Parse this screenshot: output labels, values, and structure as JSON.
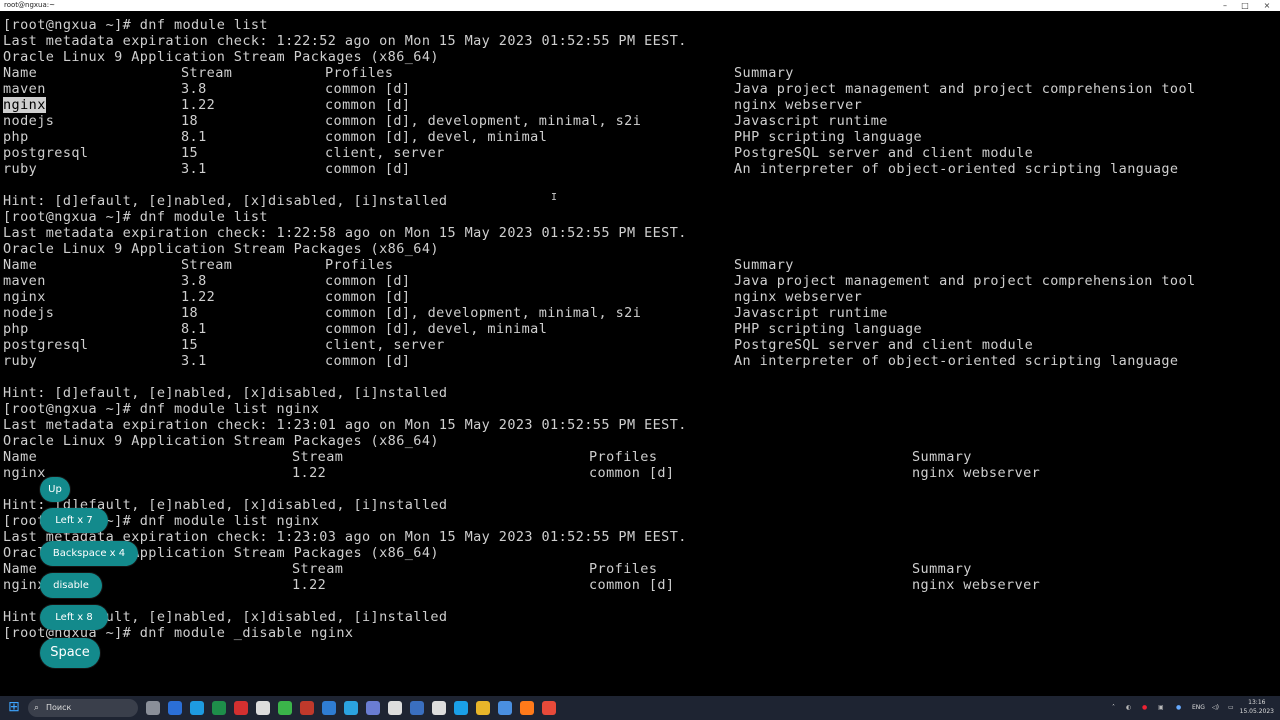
{
  "window": {
    "title": "root@ngxua:~",
    "minimize": "–",
    "maximize": "□",
    "close": "×"
  },
  "terminal": {
    "lines": [
      "[root@ngxua ~]# dnf module list",
      "Last metadata expiration check: 1:22:52 ago on Mon 15 May 2023 01:52:55 PM EEST.",
      "Oracle Linux 9 Application Stream Packages (x86_64)",
      {
        "c1": "Name",
        "c2": "Stream",
        "c3": "Profiles",
        "c4": "Summary"
      },
      {
        "c1": "maven",
        "c2": "3.8",
        "c3": "common [d]",
        "c4": "Java project management and project comprehension tool"
      },
      {
        "c1": "nginx",
        "c2": "1.22",
        "c3": "common [d]",
        "c4": "nginx webserver"
      },
      {
        "c1": "nodejs",
        "c2": "18",
        "c3": "common [d], development, minimal, s2i",
        "c4": "Javascript runtime"
      },
      {
        "c1": "php",
        "c2": "8.1",
        "c3": "common [d], devel, minimal",
        "c4": "PHP scripting language"
      },
      {
        "c1": "postgresql",
        "c2": "15",
        "c3": "client, server",
        "c4": "PostgreSQL server and client module"
      },
      {
        "c1": "ruby",
        "c2": "3.1",
        "c3": "common [d]",
        "c4": "An interpreter of object-oriented scripting language"
      },
      "",
      "Hint: [d]efault, [e]nabled, [x]disabled, [i]nstalled",
      "[root@ngxua ~]# dnf module list",
      "Last metadata expiration check: 1:22:58 ago on Mon 15 May 2023 01:52:55 PM EEST.",
      "Oracle Linux 9 Application Stream Packages (x86_64)",
      {
        "c1": "Name",
        "c2": "Stream",
        "c3": "Profiles",
        "c4": "Summary"
      },
      {
        "c1": "maven",
        "c2": "3.8",
        "c3": "common [d]",
        "c4": "Java project management and project comprehension tool"
      },
      {
        "c1": "nginx",
        "c2": "1.22",
        "c3": "common [d]",
        "c4": "nginx webserver"
      },
      {
        "c1": "nodejs",
        "c2": "18",
        "c3": "common [d], development, minimal, s2i",
        "c4": "Javascript runtime"
      },
      {
        "c1": "php",
        "c2": "8.1",
        "c3": "common [d], devel, minimal",
        "c4": "PHP scripting language"
      },
      {
        "c1": "postgresql",
        "c2": "15",
        "c3": "client, server",
        "c4": "PostgreSQL server and client module"
      },
      {
        "c1": "ruby",
        "c2": "3.1",
        "c3": "common [d]",
        "c4": "An interpreter of object-oriented scripting language"
      },
      "",
      "Hint: [d]efault, [e]nabled, [x]disabled, [i]nstalled",
      "[root@ngxua ~]# dnf module list nginx",
      "Last metadata expiration check: 1:23:01 ago on Mon 15 May 2023 01:52:55 PM EEST.",
      "Oracle Linux 9 Application Stream Packages (x86_64)",
      {
        "c1": "Name",
        "c2": "Stream",
        "c3": "Profiles",
        "c4": "Summary",
        "wide": true
      },
      {
        "c1": "nginx",
        "c2": "1.22",
        "c3": "common [d]",
        "c4": "nginx webserver",
        "wide": true
      },
      "",
      "Hint: [d]efault, [e]nabled, [x]disabled, [i]nstalled",
      "[root@ngxua ~]# dnf module list nginx",
      "Last metadata expiration check: 1:23:03 ago on Mon 15 May 2023 01:52:55 PM EEST.",
      "Oracle Linux 9 Application Stream Packages (x86_64)",
      {
        "c1": "Name",
        "c2": "Stream",
        "c3": "Profiles",
        "c4": "Summary",
        "wide": true
      },
      {
        "c1": "nginx",
        "c2": "1.22",
        "c3": "common [d]",
        "c4": "nginx webserver",
        "wide": true
      },
      "",
      "Hint: [d]efault, [e]nabled, [x]disabled, [i]nstalled",
      "[root@ngxua ~]# dnf module _disable nginx"
    ],
    "selected_text": "nginx"
  },
  "key_overlays": [
    "Up",
    "Left x 7",
    "Backspace x 4",
    "disable",
    "Left x 8",
    "Space"
  ],
  "taskbar": {
    "search_placeholder": "Поиск",
    "language": "ENG",
    "time": "13:16",
    "date": "15.05.2023"
  },
  "colors": {
    "terminal_bg": "#000000",
    "terminal_fg": "#cfcfcf",
    "overlay_bubble": "#138a8c",
    "taskbar_bg": "#1e2432"
  },
  "icons": [
    "windows-start-icon",
    "search-icon",
    "task-view-icon",
    "word-icon",
    "edge-icon",
    "excel-icon",
    "opera-icon",
    "app-icon",
    "greenshot-icon",
    "app-red-icon",
    "app-blue-icon",
    "telegram-icon",
    "app-icon-2",
    "terminal-icon",
    "app-icon-3",
    "skype-icon",
    "folder-icon",
    "notepad-icon",
    "firefox-icon",
    "chrome-icon",
    "chrome-alt-icon"
  ]
}
